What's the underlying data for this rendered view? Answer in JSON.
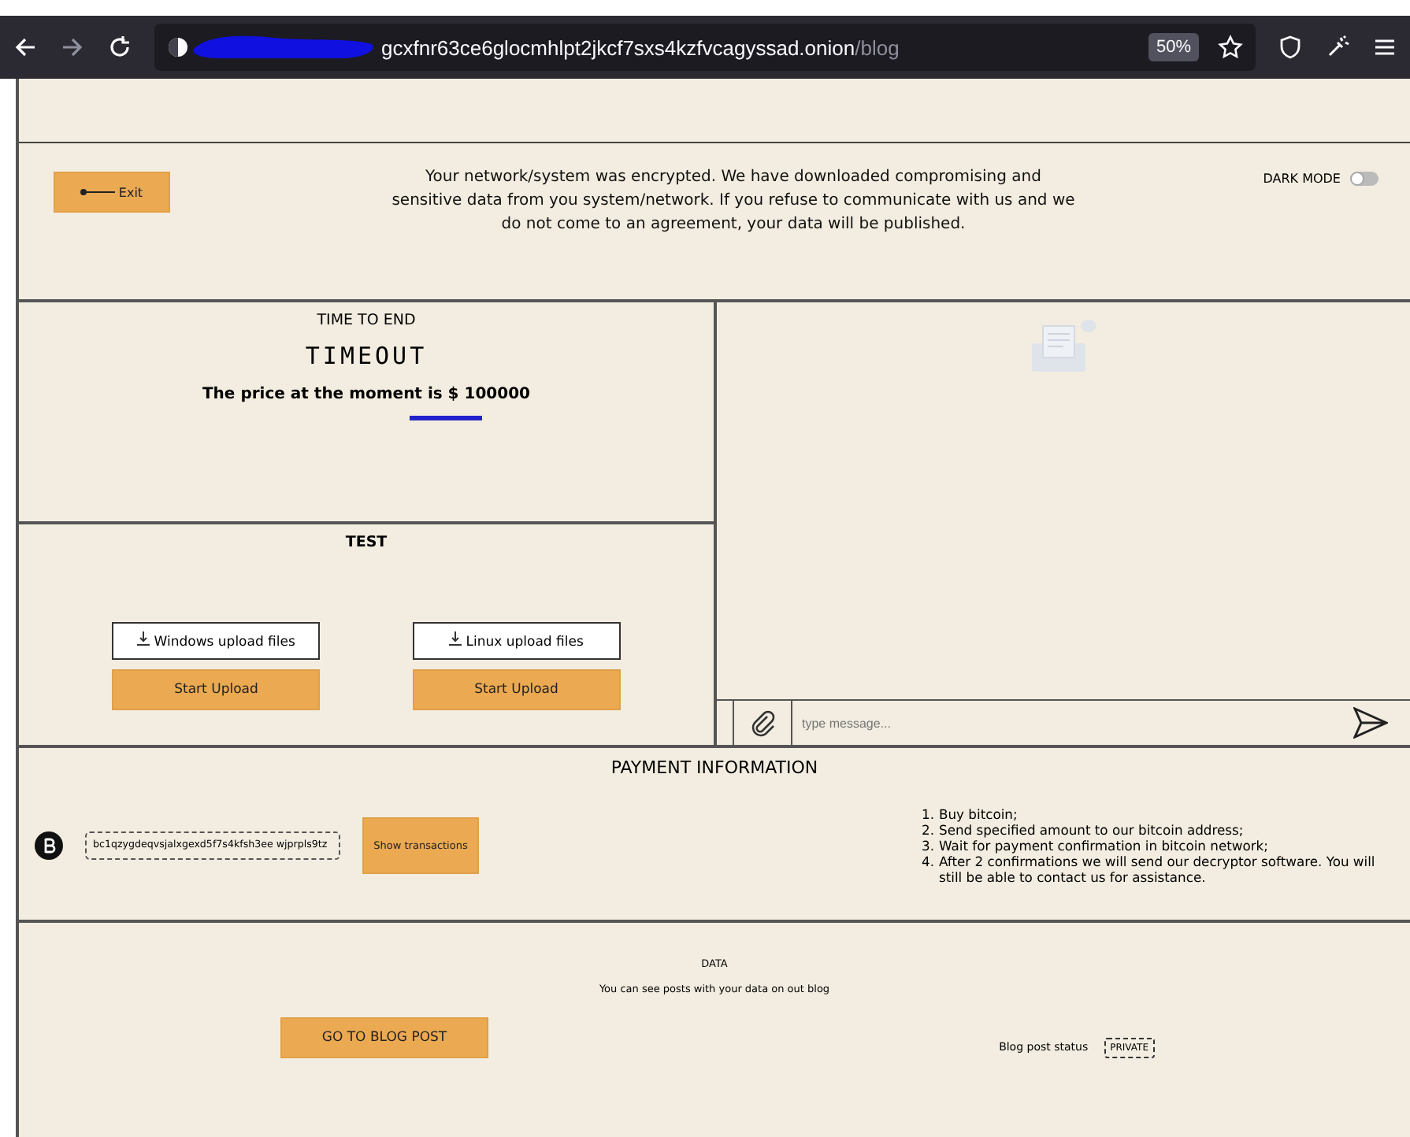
{
  "browser": {
    "url_host": "gcxfnr63ce6glocmhlpt2jkcf7sxs4kzfvcagyssad.onion",
    "url_path": "/blog",
    "zoom": "50%"
  },
  "header": {
    "exit_button": "Exit",
    "message": "Your network/system was encrypted. We have downloaded compromising and sensitive data from you system/network. If you refuse to communicate with us and we do not come to an agreement, your data will be published.",
    "dark_mode": {
      "label": "DARK MODE",
      "on": false
    }
  },
  "timer": {
    "title": "TIME TO END",
    "countdown": "TIMEOUT",
    "price": "The price at the moment is $ 100000"
  },
  "test": {
    "title": "TEST",
    "uploads": [
      {
        "label": "Windows upload files",
        "button": "Start Upload"
      },
      {
        "label": "Linux upload files",
        "button": "Start Upload"
      }
    ]
  },
  "chat": {
    "placeholder": "type message..."
  },
  "payment": {
    "title": "PAYMENT INFORMATION",
    "address": "bc1qzygdeqvsjalxgexd5f7s4kfsh3ee wjprpls9tz",
    "button": "Show transactions",
    "steps": [
      {
        "number": "1.",
        "text": "Buy bitcoin;"
      },
      {
        "number": "2.",
        "text": "Send specified amount to our bitcoin address;"
      },
      {
        "number": "3.",
        "text": "Wait for payment confirmation in bitcoin network;"
      },
      {
        "number": "4.",
        "text": "After 2 confirmations we will send our decryptor software. You will still be able to contact us for assistance."
      }
    ]
  },
  "data": {
    "title": "DATA",
    "text": "You can see posts with your data on out blog",
    "button": "GO TO BLOG POST",
    "status_label": "Blog post status",
    "status": "PRIVATE"
  }
}
